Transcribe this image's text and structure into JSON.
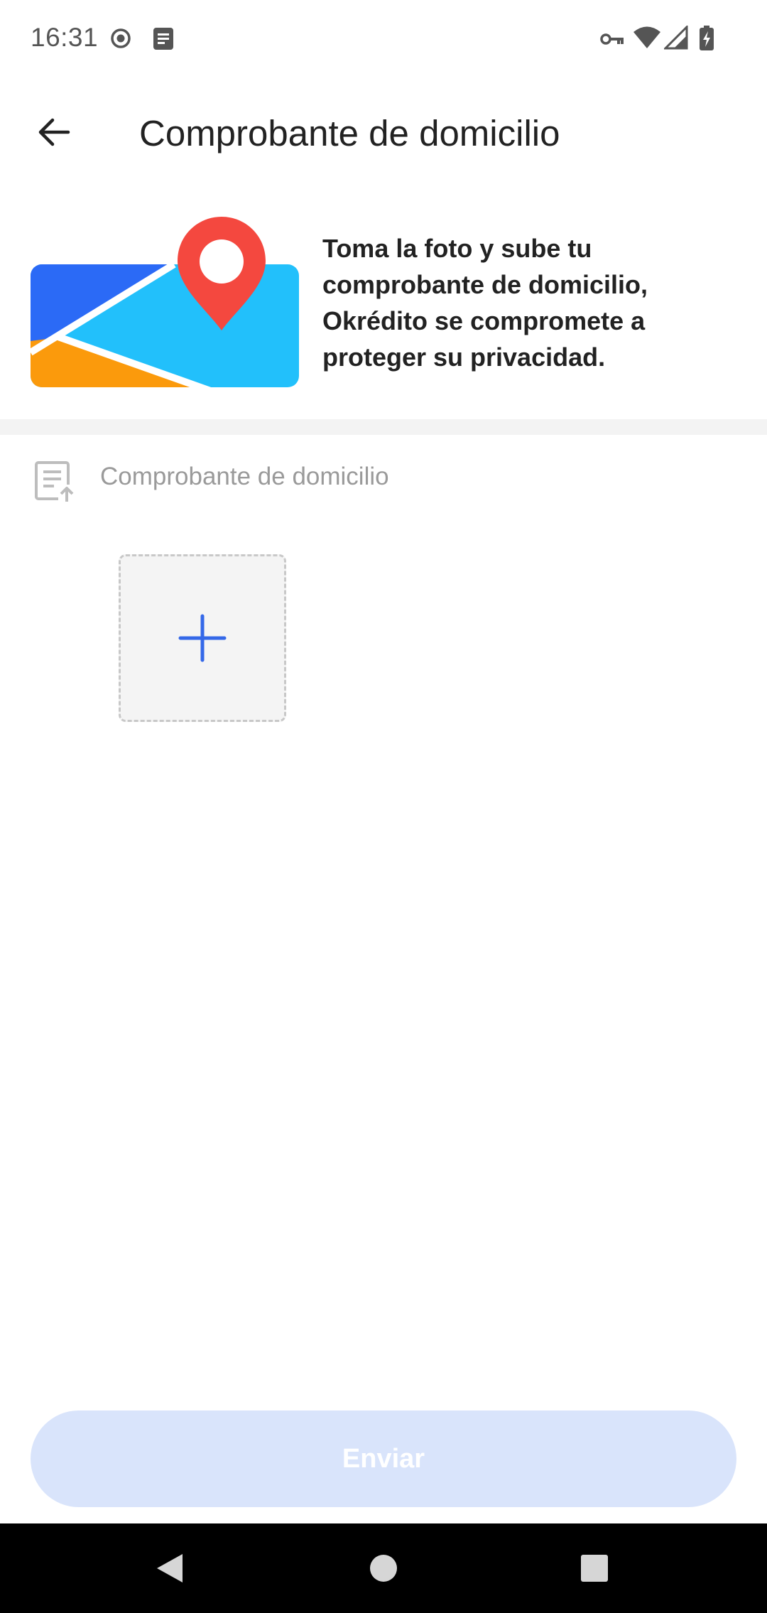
{
  "status_bar": {
    "time": "16:31",
    "left_icons": [
      "record-icon",
      "notes-icon"
    ],
    "right_icons": [
      "vpn-key-icon",
      "wifi-icon",
      "signal-icon",
      "battery-charging-icon"
    ]
  },
  "header": {
    "back_icon": "arrow-back-icon",
    "title": "Comprobante de domicilio"
  },
  "intro": {
    "illustration": "map-location-pin-illustration",
    "text": "Toma la foto y sube tu comprobante de domicilio, Okrédito se compromete a proteger su privacidad."
  },
  "document_section": {
    "icon": "document-upload-icon",
    "label": "Comprobante de domicilio",
    "upload_icon": "plus-icon"
  },
  "submit": {
    "label": "Enviar"
  },
  "nav_bar": {
    "buttons": [
      "back-triangle-icon",
      "home-circle-icon",
      "recents-square-icon"
    ]
  },
  "colors": {
    "accent_blue": "#3468e8",
    "submit_disabled_bg": "#d9e4fb",
    "pin_red": "#f4483f",
    "map_blue": "#2b6af6",
    "map_light_blue": "#22c0fb",
    "map_orange": "#fb9a0c"
  }
}
